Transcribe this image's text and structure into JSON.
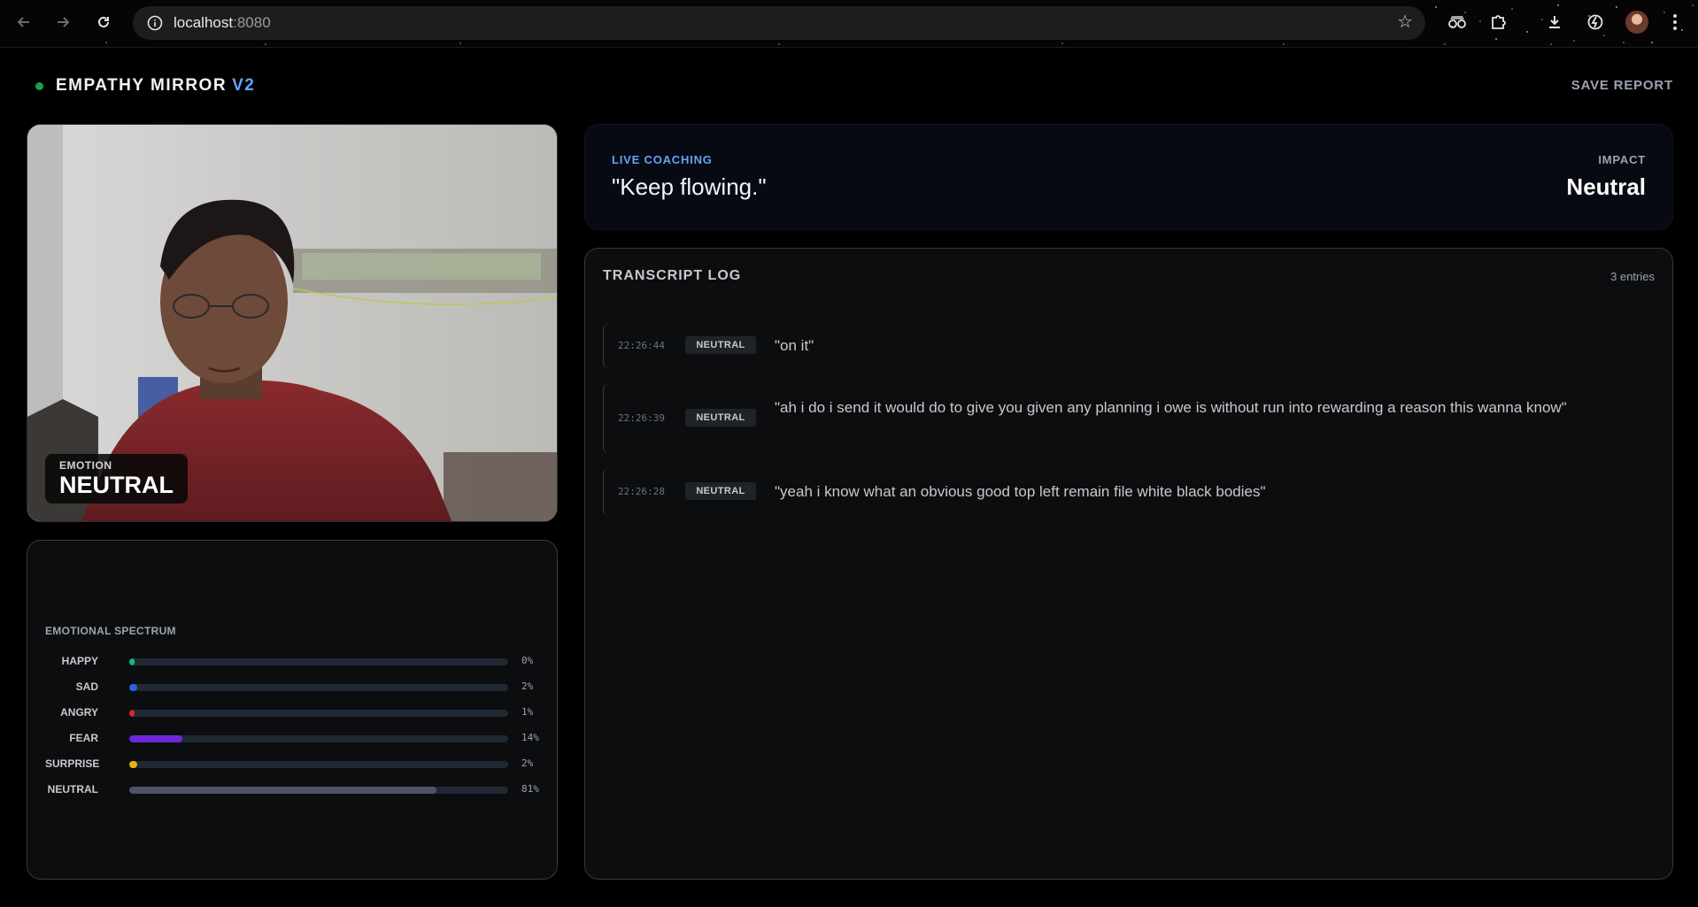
{
  "browser": {
    "url_host": "localhost",
    "url_port": ":8080"
  },
  "app": {
    "brand": "EMPATHY MIRROR",
    "version": "V2",
    "save_label": "SAVE REPORT",
    "status_color": "#16a34a",
    "accent_color": "#60a5fa"
  },
  "camera": {
    "emotion_label": "EMOTION",
    "emotion_value": "NEUTRAL"
  },
  "spectrum": {
    "title": "EMOTIONAL SPECTRUM",
    "items": [
      {
        "label": "HAPPY",
        "pct": "0%",
        "value": 0,
        "color": "#10b981"
      },
      {
        "label": "SAD",
        "pct": "2%",
        "value": 2,
        "color": "#2563eb"
      },
      {
        "label": "ANGRY",
        "pct": "1%",
        "value": 1,
        "color": "#dc2626"
      },
      {
        "label": "FEAR",
        "pct": "14%",
        "value": 14,
        "color": "#6d28d9"
      },
      {
        "label": "SURPRISE",
        "pct": "2%",
        "value": 2,
        "color": "#eab308"
      },
      {
        "label": "NEUTRAL",
        "pct": "81%",
        "value": 81,
        "color": "#4b5563"
      }
    ]
  },
  "coaching": {
    "label": "LIVE COACHING",
    "text": "\"Keep flowing.\"",
    "impact_label": "IMPACT",
    "impact_value": "Neutral"
  },
  "transcript": {
    "title": "TRANSCRIPT LOG",
    "count": "3 entries",
    "entries": [
      {
        "time": "22:26:44",
        "tag": "NEUTRAL",
        "text": "\"on it\""
      },
      {
        "time": "22:26:39",
        "tag": "NEUTRAL",
        "text": "\"ah i do i send it would do to give you given any planning i owe is without run into rewarding a reason this wanna know\""
      },
      {
        "time": "22:26:28",
        "tag": "NEUTRAL",
        "text": "\"yeah i know what an obvious good top left remain file white black bodies\""
      }
    ]
  }
}
